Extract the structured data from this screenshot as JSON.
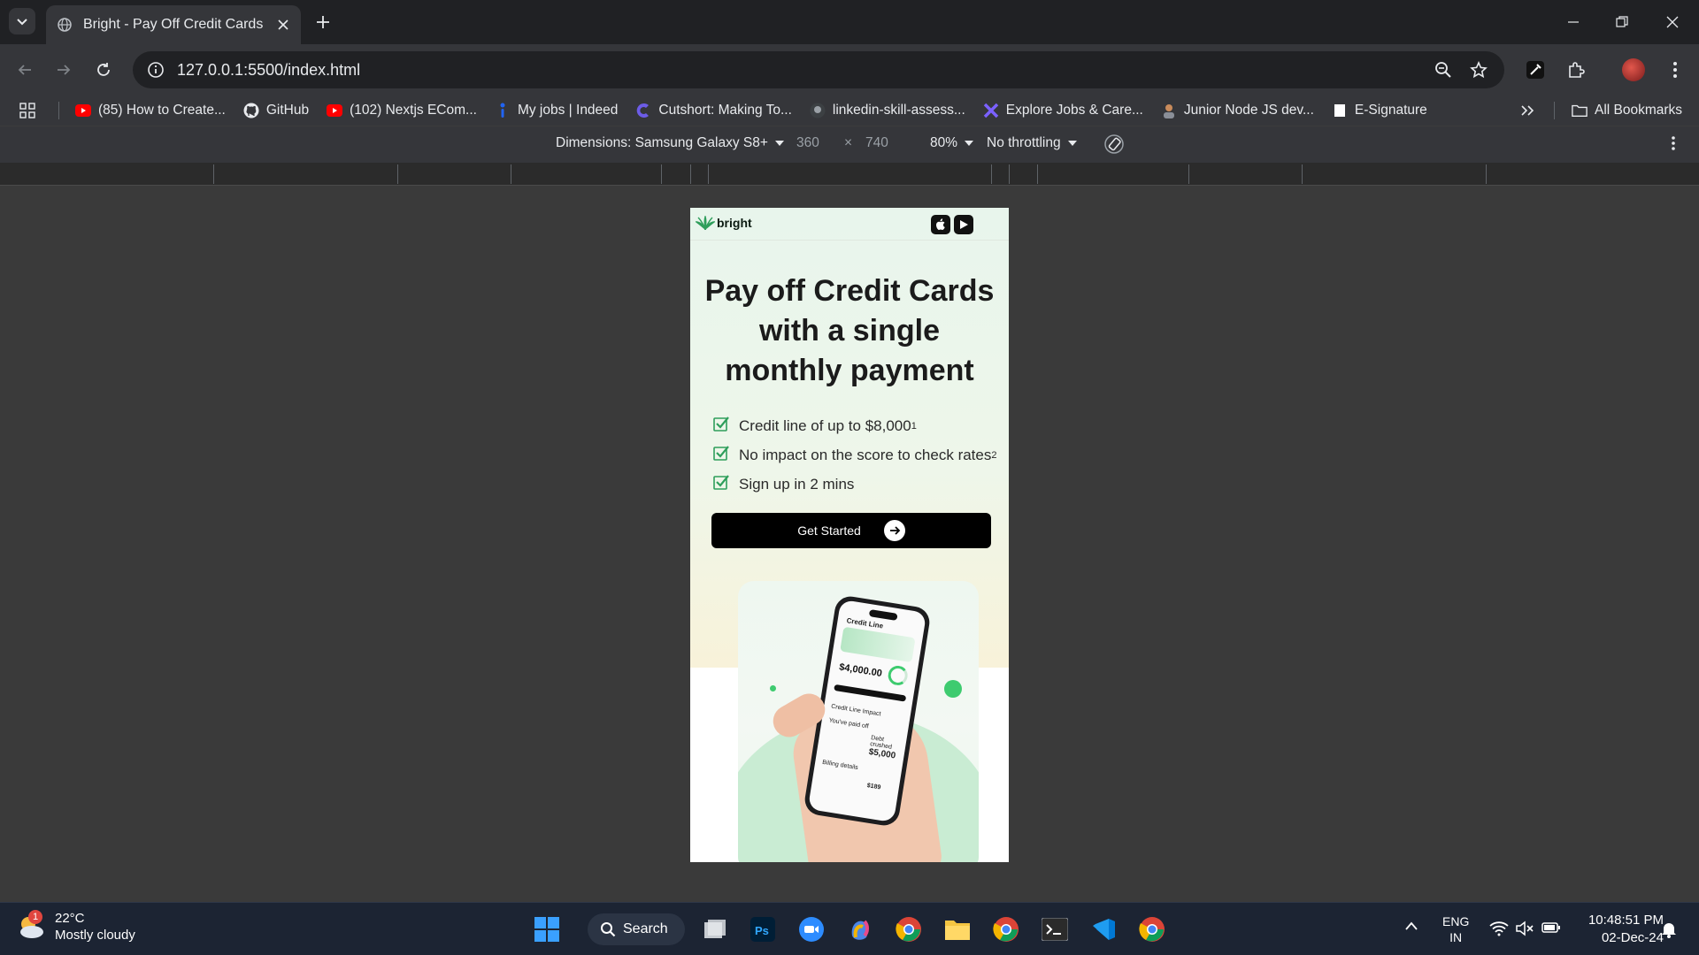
{
  "browser": {
    "tab_title": "Bright - Pay Off Credit Cards",
    "url": "127.0.0.1:5500/index.html",
    "all_bookmarks_label": "All Bookmarks",
    "bookmarks": [
      {
        "label": "(85) How to Create...",
        "icon": "youtube-icon",
        "color": "#ff0000"
      },
      {
        "label": "GitHub",
        "icon": "github-icon",
        "color": "#ffffff"
      },
      {
        "label": "(102) Nextjs ECom...",
        "icon": "youtube-icon",
        "color": "#ff0000"
      },
      {
        "label": "My jobs | Indeed",
        "icon": "indeed-icon",
        "color": "#2164f3"
      },
      {
        "label": "Cutshort: Making To...",
        "icon": "cutshort-icon",
        "color": "#6c5ce7"
      },
      {
        "label": "linkedin-skill-assess...",
        "icon": "github-icon",
        "color": "#ffffff"
      },
      {
        "label": "Explore Jobs & Care...",
        "icon": "x-icon",
        "color": "#7b61ff"
      },
      {
        "label": "Junior Node JS dev...",
        "icon": "person-icon",
        "color": "#c98b5b"
      },
      {
        "label": "E-Signature",
        "icon": "document-icon",
        "color": "#ffffff"
      }
    ]
  },
  "devtools": {
    "dimensions_label": "Dimensions: Samsung Galaxy S8+",
    "width": "360",
    "times": "×",
    "height": "740",
    "zoom": "80%",
    "throttling": "No throttling"
  },
  "page": {
    "logo_text": "bright",
    "hero_title": "Pay off Credit Cards with a single monthly payment",
    "features": [
      {
        "text": "Credit line of up to $8,000",
        "sup": "1"
      },
      {
        "text": "No impact on the score to check rates",
        "sup": "2"
      },
      {
        "text": "Sign up in 2 mins",
        "sup": ""
      }
    ],
    "cta_label": "Get Started",
    "accent_color": "#2e9e5b",
    "phone_screen": {
      "header": "Credit Line",
      "amount": "$4,000.00",
      "section": "Credit Line Impact",
      "paid_off": "You've paid off",
      "debt": "Debt crushed",
      "debt_amount": "$5,000",
      "billing": "Billing details",
      "bill_amount": "$189"
    }
  },
  "taskbar": {
    "weather_temp": "22°C",
    "weather_desc": "Mostly cloudy",
    "weather_badge": "1",
    "search_label": "Search",
    "lang_top": "ENG",
    "lang_bottom": "IN",
    "time": "10:48:51 PM",
    "date": "02-Dec-24"
  }
}
